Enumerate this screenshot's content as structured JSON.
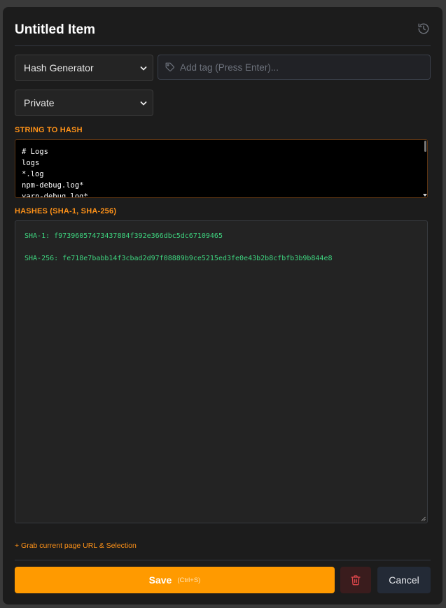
{
  "header": {
    "title": "Untitled Item",
    "history_icon": "history-icon"
  },
  "controls": {
    "type_select": {
      "selected": "Hash Generator",
      "options": [
        "Hash Generator"
      ]
    },
    "tag_input": {
      "placeholder": "Add tag (Press Enter)...",
      "value": "",
      "icon": "tag-icon"
    },
    "visibility_select": {
      "selected": "Private",
      "options": [
        "Private"
      ]
    }
  },
  "input_section": {
    "label": "STRING TO HASH",
    "value": "# Logs\nlogs\n*.log\nnpm-debug.log*\nyarn-debug.log*"
  },
  "output_section": {
    "label": "HASHES (SHA-1, SHA-256)",
    "sha1": "SHA-1: f97396057473437884f392e366dbc5dc67109465",
    "sha256": "SHA-256: fe718e7babb14f3cbad2d97f08889b9ce5215ed3fe0e43b2b8cfbfb3b9b844e8"
  },
  "footer": {
    "grab_link": "+ Grab current page URL & Selection",
    "save_label": "Save",
    "save_shortcut": "(Ctrl+S)",
    "delete_icon": "trash-icon",
    "cancel_label": "Cancel"
  },
  "colors": {
    "accent": "#ff9a00",
    "label": "#ff9218",
    "hash_text": "#3ed47f",
    "panel_bg": "#1c1c1c",
    "delete_bg": "#3a1c1d",
    "delete_icon": "#e0474c"
  }
}
